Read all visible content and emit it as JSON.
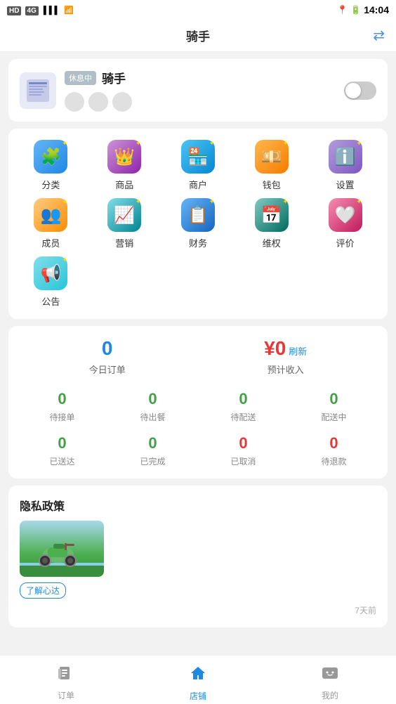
{
  "statusBar": {
    "left": "HD 4G",
    "time": "14:04",
    "signalLabel": "signal"
  },
  "topNav": {
    "title": "骑手",
    "actionIcon": "⇄"
  },
  "riderCard": {
    "avatarIcon": "📄",
    "badge": "休息中",
    "name": "骑手",
    "toggleState": "off"
  },
  "menu": {
    "items": [
      {
        "id": "fenlei",
        "label": "分类",
        "icon": "🧩",
        "iconClass": "icon-fenlei"
      },
      {
        "id": "shangpin",
        "label": "商品",
        "icon": "👑",
        "iconClass": "icon-shangpin"
      },
      {
        "id": "shanghhu",
        "label": "商户",
        "icon": "🏪",
        "iconClass": "icon-shanghhu"
      },
      {
        "id": "qianbao",
        "label": "钱包",
        "icon": "💴",
        "iconClass": "icon-qianbao"
      },
      {
        "id": "shezhi",
        "label": "设置",
        "icon": "ℹ️",
        "iconClass": "icon-shezhi"
      },
      {
        "id": "chengyuan",
        "label": "成员",
        "icon": "👥",
        "iconClass": "icon-chengyuan"
      },
      {
        "id": "yingxiao",
        "label": "营销",
        "icon": "📊",
        "iconClass": "icon-yingxiao"
      },
      {
        "id": "caiwu",
        "label": "财务",
        "icon": "📋",
        "iconClass": "icon-caiwu"
      },
      {
        "id": "weiquan",
        "label": "维权",
        "icon": "📅",
        "iconClass": "icon-weiquan"
      },
      {
        "id": "pingjia",
        "label": "评价",
        "icon": "🤍",
        "iconClass": "icon-pingjia"
      },
      {
        "id": "gonggao",
        "label": "公告",
        "icon": "📢",
        "iconClass": "icon-gonggao"
      }
    ]
  },
  "stats": {
    "todayOrders": "0",
    "todayOrdersLabel": "今日订单",
    "estimatedIncome": "¥0",
    "estimatedIncomeLabel": "预计收入",
    "refreshLabel": "刷新",
    "grid": [
      {
        "id": "daijiedan",
        "value": "0",
        "label": "待接单",
        "color": "green"
      },
      {
        "id": "daichucan",
        "value": "0",
        "label": "待出餐",
        "color": "green"
      },
      {
        "id": "daipeisong",
        "value": "0",
        "label": "待配送",
        "color": "green"
      },
      {
        "id": "peisongzhong",
        "value": "0",
        "label": "配送中",
        "color": "green"
      },
      {
        "id": "yisongda",
        "value": "0",
        "label": "已送达",
        "color": "green"
      },
      {
        "id": "yiwancheng",
        "value": "0",
        "label": "已完成",
        "color": "green"
      },
      {
        "id": "yiquxiao",
        "value": "0",
        "label": "已取消",
        "color": "red"
      },
      {
        "id": "daituikuan",
        "value": "0",
        "label": "待退款",
        "color": "red"
      }
    ]
  },
  "news": {
    "title": "隐私政策",
    "metaTime": "7天前",
    "learnMoreLabel": "了解心达"
  },
  "bottomNav": {
    "items": [
      {
        "id": "orders",
        "icon": "🧾",
        "label": "订单",
        "active": false
      },
      {
        "id": "store",
        "icon": "🏠",
        "label": "店铺",
        "active": true
      },
      {
        "id": "mine",
        "icon": "💬",
        "label": "我的",
        "active": false
      }
    ]
  }
}
